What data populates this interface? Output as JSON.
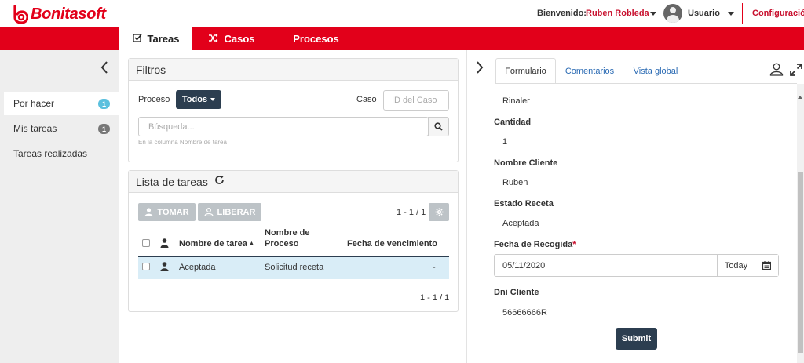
{
  "brand": {
    "name": "Bonitasoft",
    "color": "#e2001a"
  },
  "header": {
    "welcome_label": "Bienvenido:",
    "welcome_user": "Ruben Robleda",
    "user_label": "Usuario",
    "config_label": "Configuración"
  },
  "nav": {
    "tabs": [
      {
        "label": "Tareas",
        "icon": "checkbox-icon",
        "active": true
      },
      {
        "label": "Casos",
        "icon": "shuffle-icon",
        "active": false
      },
      {
        "label": "Procesos",
        "icon": "",
        "active": false
      }
    ]
  },
  "sidebar": {
    "items": [
      {
        "label": "Por hacer",
        "badge": "1",
        "badge_color": "#5bc0de",
        "active": true
      },
      {
        "label": "Mis tareas",
        "badge": "1",
        "badge_color": "#777777",
        "active": false
      },
      {
        "label": "Tareas realizadas",
        "badge": "",
        "active": false
      }
    ]
  },
  "filters": {
    "title": "Filtros",
    "process_label": "Proceso",
    "process_value": "Todos",
    "case_label": "Caso",
    "case_placeholder": "ID del Caso",
    "search_placeholder": "Búsqueda...",
    "search_hint": "En la columna Nombre de tarea"
  },
  "task_list": {
    "title": "Lista de tareas",
    "take_label": "TOMAR",
    "release_label": "LIBERAR",
    "pagination_top": "1 - 1 / 1",
    "pagination_bottom": "1 - 1 / 1",
    "columns": [
      "Nombre de tarea",
      "Nombre de Proceso",
      "Fecha de vencimiento"
    ],
    "column_process_line1": "Nombre de",
    "column_process_line2": "Proceso",
    "rows": [
      {
        "task": "Aceptada",
        "process": "Solicitud receta",
        "due": "-"
      }
    ]
  },
  "detail": {
    "tabs": [
      "Formulario",
      "Comentarios",
      "Vista global"
    ],
    "fields": {
      "first_value": "Rinaler",
      "cantidad_label": "Cantidad",
      "cantidad_value": "1",
      "cliente_label": "Nombre Cliente",
      "cliente_value": "Ruben",
      "estado_label": "Estado Receta",
      "estado_value": "Aceptada",
      "fecha_label": "Fecha de Recogida",
      "fecha_required": "*",
      "fecha_value": "05/11/2020",
      "today_label": "Today",
      "dni_label": "Dni Cliente",
      "dni_value": "56666666R"
    },
    "submit_label": "Submit"
  }
}
